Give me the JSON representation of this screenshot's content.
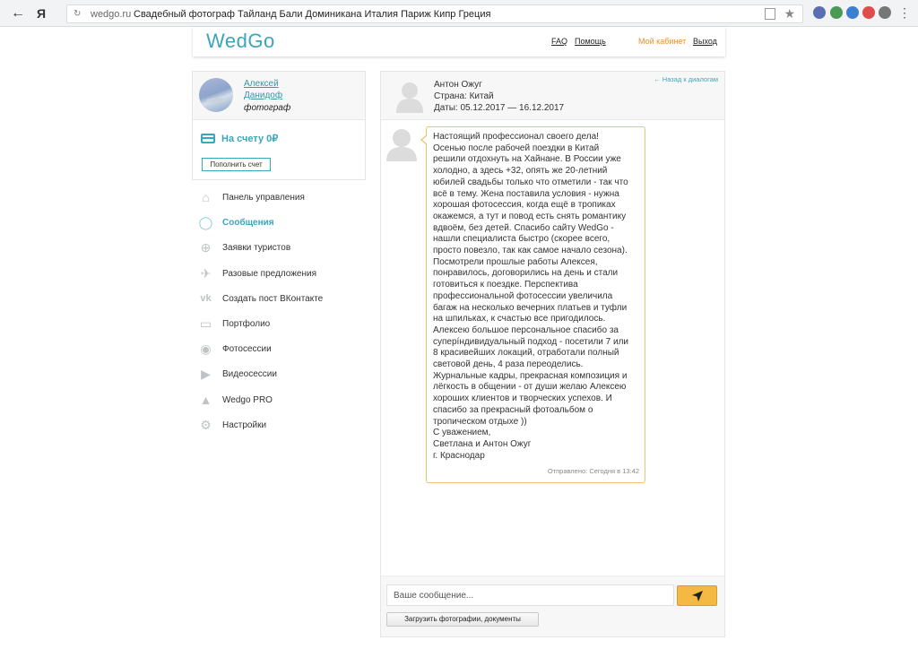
{
  "browser": {
    "url": "wedgo.ru",
    "page_title": "Свадебный фотограф Тайланд Бали Доминикана Италия Париж Кипр Греция"
  },
  "header": {
    "logo": "WedGo",
    "faq": "FAQ",
    "help": "Помощь",
    "cabinet": "Мой кабинет",
    "logout": "Выход"
  },
  "profile": {
    "first_name": "Алексей",
    "last_name": "Данидоф",
    "role": "фотограф",
    "balance": "На счету 0₽",
    "topup_label": "Пополнить счет"
  },
  "menu": [
    {
      "label": "Панель управления",
      "icon": "home-icon",
      "glyph": "⌂"
    },
    {
      "label": "Сообщения",
      "icon": "chat-icon",
      "glyph": "◯"
    },
    {
      "label": "Заявки туристов",
      "icon": "globe-icon",
      "glyph": "⊕"
    },
    {
      "label": "Разовые предложения",
      "icon": "plane-icon",
      "glyph": "✈"
    },
    {
      "label": "Создать пост ВКонтакте",
      "icon": "vk-icon",
      "glyph": "vk"
    },
    {
      "label": "Портфолио",
      "icon": "briefcase-icon",
      "glyph": "▭"
    },
    {
      "label": "Фотосессии",
      "icon": "camera-icon",
      "glyph": "◉"
    },
    {
      "label": "Видеосессии",
      "icon": "video-icon",
      "glyph": "▶"
    },
    {
      "label": "Wedgo PRO",
      "icon": "graduation-cap-icon",
      "glyph": "▲"
    },
    {
      "label": "Настройки",
      "icon": "gear-icon",
      "glyph": "⚙"
    }
  ],
  "dialog": {
    "name": "Антон Ожуг",
    "country": "Страна: Китай",
    "dates": "Даты: 05.12.2017 — 16.12.2017",
    "back_link": "← Назад к диалогам",
    "message_lines": [
      "Настоящий профессионал своего дела!",
      "Осенью после рабочей поездки в Китай",
      "решили отдохнуть на Хайнане. В России уже",
      "холодно, а здесь +32, опять же 20-летний",
      "юбилей свадьбы только что отметили - так что",
      "всё в тему. Жена поставила условия - нужна",
      "хорошая фотосессия, когда ещё в тропиках",
      "окажемся, а тут и повод есть снять романтику",
      "вдвоём, без детей. Спасибо сайту WedGo -",
      "нашли специалиста быстро (скорее всего,",
      "просто повезло, так как самое начало сезона).",
      "Посмотрели прошлые работы Алексея,",
      "понравилось, договорились на день и стали",
      "готовиться к поездке. Перспектива",
      "профессиональной фотосессии увеличила",
      "багаж на несколько вечерних платьев и туфли",
      "на шпильках, к счастью все пригодилось.",
      "Алексею большое персональное спасибо за",
      "суперíндивидуальный подход - посетили 7 или",
      "8 красивейших локаций, отработали полный",
      "световой день, 4 раза переоделись.",
      "Журнальные кадры, прекрасная композиция и",
      "лёгкость в общении - от души желаю Алексею",
      "хороших клиентов и творческих успехов. И",
      "спасибо за прекрасный фотоальбом о",
      "тропическом отдыхе ))",
      "С уважением,",
      "Светлана и Антон Ожуг",
      "г. Краснодар"
    ],
    "sent_label": "Отправлено: Сегодня в 13:42",
    "input_placeholder": "Ваше сообщение...",
    "upload_label": "Загрузить фотографии, документы"
  },
  "colors": {
    "accent": "#3aa7b8",
    "orange": "#e8902b",
    "bubble_border": "#f0c36d",
    "send_button": "#f3b942"
  }
}
